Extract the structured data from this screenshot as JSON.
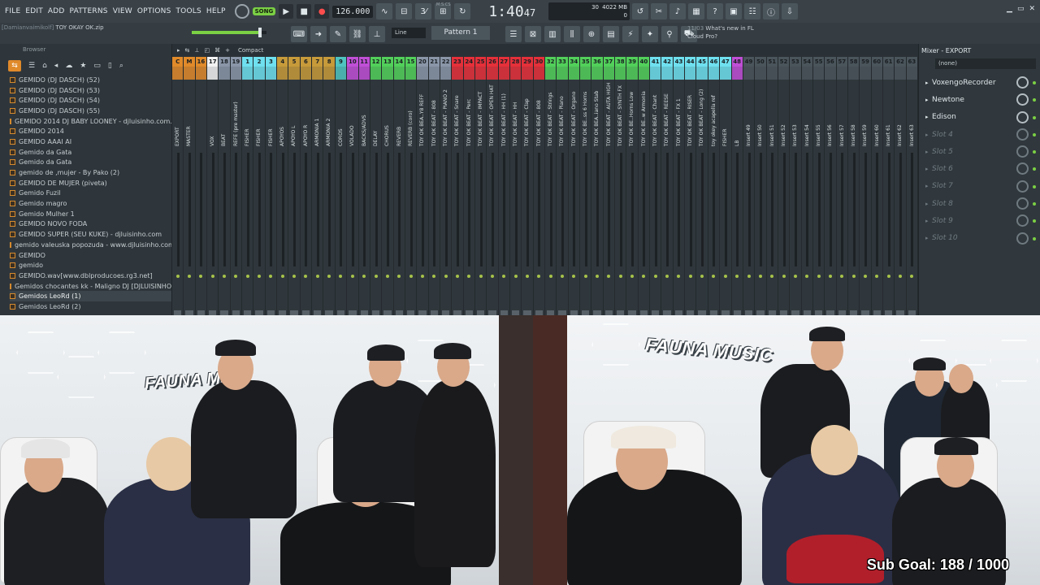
{
  "menu": [
    "FILE",
    "EDIT",
    "ADD",
    "PATTERNS",
    "VIEW",
    "OPTIONS",
    "TOOLS",
    "HELP"
  ],
  "transport": {
    "mode": "SONG",
    "tempo": "126.000",
    "time_main": "1:40",
    "time_sub": "47",
    "time_unit": "M:S:CS"
  },
  "cpu": {
    "cores": "30",
    "memory": "4022 MB",
    "polyphony": "0"
  },
  "project": {
    "author": "[Damianvaimikolf]",
    "file": "TOY OKAY OK.zip"
  },
  "toolbar2": {
    "snap": "Line",
    "pattern": "Pattern 1"
  },
  "news": {
    "date": "11/03",
    "headline": "What's new in FL",
    "sub": "Cloud Pro?"
  },
  "browser": {
    "title": "Browser",
    "files": [
      "GEMIDO (DJ DASCH) (52)",
      "GEMIDO (DJ DASCH) (53)",
      "GEMIDO (DJ DASCH) (54)",
      "GEMIDO (DJ DASCH) (55)",
      "GEMIDO 2014 DJ BABY LOONEY - djluisinho.com.br",
      "GEMIDO 2014",
      "GEMIDO AAAI AI",
      "Gemido da Gata",
      "Gemido da Gata",
      "gemido de ,mujer - By Pako (2)",
      "GEMIDO DE MUJER (piveta)",
      "Gemido Fuzil",
      "Gemido magro",
      "Gemido Mulher 1",
      "GEMIDO NOVO FODA",
      "GEMIDO SUPER (SEU KUKE) - djluisinho.com",
      "gemido valeuska popozuda - www.djluisinho.com",
      "GEMIDO",
      "gemido",
      "GEMIDO.wav[www.dblproducoes.rg3.net]",
      "Gemidos chocantes kk - Maligno DJ [DJLUISINHO.com.br]",
      "Gemidos LeoRd (1)",
      "Gemidos LeoRd (2)"
    ],
    "selected_index": 21
  },
  "mixer": {
    "compact_label": "Compact",
    "strips": [
      {
        "num": "C",
        "name": "EXPORT",
        "color": "#e08a2a"
      },
      {
        "num": "M",
        "name": "MASTER",
        "color": "#e08a2a"
      },
      {
        "num": "16",
        "name": "",
        "color": "#e08a2a"
      },
      {
        "num": "17",
        "name": "VOX",
        "color": "#f2f2f2"
      },
      {
        "num": "18",
        "name": "BEAT",
        "color": "#8a96a8"
      },
      {
        "num": "19",
        "name": "REFE (pre master)",
        "color": "#8a96a8"
      },
      {
        "num": "1",
        "name": "FISHER",
        "color": "#6fe0ef"
      },
      {
        "num": "2",
        "name": "FISHER",
        "color": "#6fe0ef"
      },
      {
        "num": "3",
        "name": "FISHER",
        "color": "#6fe0ef"
      },
      {
        "num": "4",
        "name": "APOYOS",
        "color": "#c79a3a"
      },
      {
        "num": "5",
        "name": "APOYO L",
        "color": "#c79a3a"
      },
      {
        "num": "6",
        "name": "APOYO R",
        "color": "#c79a3a"
      },
      {
        "num": "7",
        "name": "ARMONIA 1",
        "color": "#c79a3a"
      },
      {
        "num": "8",
        "name": "ARMONIA 2",
        "color": "#c79a3a"
      },
      {
        "num": "9",
        "name": "COROS",
        "color": "#4fc3c0"
      },
      {
        "num": "10",
        "name": "VOLADO",
        "color": "#c04fd6"
      },
      {
        "num": "11",
        "name": "BACKS/ADVS",
        "color": "#c04fd6"
      },
      {
        "num": "12",
        "name": "DELAY",
        "color": "#52d05a"
      },
      {
        "num": "13",
        "name": "CHORUS",
        "color": "#52d05a"
      },
      {
        "num": "14",
        "name": "REVERB",
        "color": "#52d05a"
      },
      {
        "num": "15",
        "name": "REVERB (coro)",
        "color": "#52d05a"
      },
      {
        "num": "20",
        "name": "TOY OK BEA..Y8 REFF",
        "color": "#8a96a8"
      },
      {
        "num": "21",
        "name": "TOY OK BEAT - 808",
        "color": "#8a96a8"
      },
      {
        "num": "22",
        "name": "TOY OK BEAT - PIANO 2",
        "color": "#8a96a8"
      },
      {
        "num": "23",
        "name": "TOY OK BEAT - Snare",
        "color": "#e5303a"
      },
      {
        "num": "24",
        "name": "TOY OK BEAT - Perc",
        "color": "#e5303a"
      },
      {
        "num": "25",
        "name": "TOY OK BEAT - IMPACT",
        "color": "#e5303a"
      },
      {
        "num": "26",
        "name": "TOY OK BEAT - OPEN HAT",
        "color": "#e5303a"
      },
      {
        "num": "27",
        "name": "TOY OK BEAT - HH (1)",
        "color": "#e5303a"
      },
      {
        "num": "28",
        "name": "TOY OK BEAT - HH",
        "color": "#e5303a"
      },
      {
        "num": "29",
        "name": "TOY OK BEAT - Clap",
        "color": "#e5303a"
      },
      {
        "num": "30",
        "name": "TOY OK BEAT - 808",
        "color": "#e5303a"
      },
      {
        "num": "32",
        "name": "TOY OK BEAT - Strings",
        "color": "#52d05a"
      },
      {
        "num": "33",
        "name": "TOY OK BEAT - Piano",
        "color": "#52d05a"
      },
      {
        "num": "34",
        "name": "TOY OK BEAT - Organo",
        "color": "#52d05a"
      },
      {
        "num": "35",
        "name": "TOY OK BE..ss 6 Horns",
        "color": "#52d05a"
      },
      {
        "num": "36",
        "name": "TOY OK BEA..iano Stab",
        "color": "#52d05a"
      },
      {
        "num": "37",
        "name": "TOY OK BEAT - AUTA HIGH",
        "color": "#52d05a"
      },
      {
        "num": "38",
        "name": "TOY OK BEAT - SYNTH FX",
        "color": "#52d05a"
      },
      {
        "num": "39",
        "name": "TOY OK BE..Horns Low",
        "color": "#52d05a"
      },
      {
        "num": "40",
        "name": "TOY OK BE..w Armonia",
        "color": "#52d05a"
      },
      {
        "num": "41",
        "name": "TOY OK BEAT - Chant",
        "color": "#6fe0ef"
      },
      {
        "num": "42",
        "name": "TOY OK BEAT - REESE",
        "color": "#6fe0ef"
      },
      {
        "num": "43",
        "name": "TOY OK BEAT - FX 1",
        "color": "#6fe0ef"
      },
      {
        "num": "44",
        "name": "TOY OK BEAT - RISER",
        "color": "#6fe0ef"
      },
      {
        "num": "45",
        "name": "TOY OK BEAT - Long (2)",
        "color": "#6fe0ef"
      },
      {
        "num": "46",
        "name": "toy okey acapella ref",
        "color": "#6fe0ef"
      },
      {
        "num": "47",
        "name": "FISHER",
        "color": "#6fe0ef"
      },
      {
        "num": "48",
        "name": "LB",
        "color": "#c04fd6"
      },
      {
        "num": "49",
        "name": "Insert 49",
        "color": "#4a545b"
      },
      {
        "num": "50",
        "name": "Insert 50",
        "color": "#4a545b"
      },
      {
        "num": "51",
        "name": "Insert 51",
        "color": "#4a545b"
      },
      {
        "num": "52",
        "name": "Insert 52",
        "color": "#4a545b"
      },
      {
        "num": "53",
        "name": "Insert 53",
        "color": "#4a545b"
      },
      {
        "num": "54",
        "name": "Insert 54",
        "color": "#4a545b"
      },
      {
        "num": "55",
        "name": "Insert 55",
        "color": "#4a545b"
      },
      {
        "num": "56",
        "name": "Insert 56",
        "color": "#4a545b"
      },
      {
        "num": "57",
        "name": "Insert 57",
        "color": "#4a545b"
      },
      {
        "num": "58",
        "name": "Insert 58",
        "color": "#4a545b"
      },
      {
        "num": "59",
        "name": "Insert 59",
        "color": "#4a545b"
      },
      {
        "num": "60",
        "name": "Insert 60",
        "color": "#4a545b"
      },
      {
        "num": "61",
        "name": "Insert 61",
        "color": "#4a545b"
      },
      {
        "num": "62",
        "name": "Insert 62",
        "color": "#4a545b"
      },
      {
        "num": "63",
        "name": "Insert 63",
        "color": "#4a545b"
      }
    ]
  },
  "insert_panel": {
    "title": "Mixer - EXPORT",
    "preset": "(none)",
    "slots": [
      {
        "name": "VoxengoRecorder",
        "empty": false
      },
      {
        "name": "Newtone",
        "empty": false
      },
      {
        "name": "Edison",
        "empty": false
      },
      {
        "name": "Slot 4",
        "empty": true
      },
      {
        "name": "Slot 5",
        "empty": true
      },
      {
        "name": "Slot 6",
        "empty": true
      },
      {
        "name": "Slot 7",
        "empty": true
      },
      {
        "name": "Slot 8",
        "empty": true
      },
      {
        "name": "Slot 9",
        "empty": true
      },
      {
        "name": "Slot 10",
        "empty": true
      }
    ]
  },
  "overlay": {
    "watermark_left": "FAUNA M",
    "watermark_right": "FAUNA MUSIC",
    "sub_goal": "Sub Goal: 188 / 1000"
  }
}
